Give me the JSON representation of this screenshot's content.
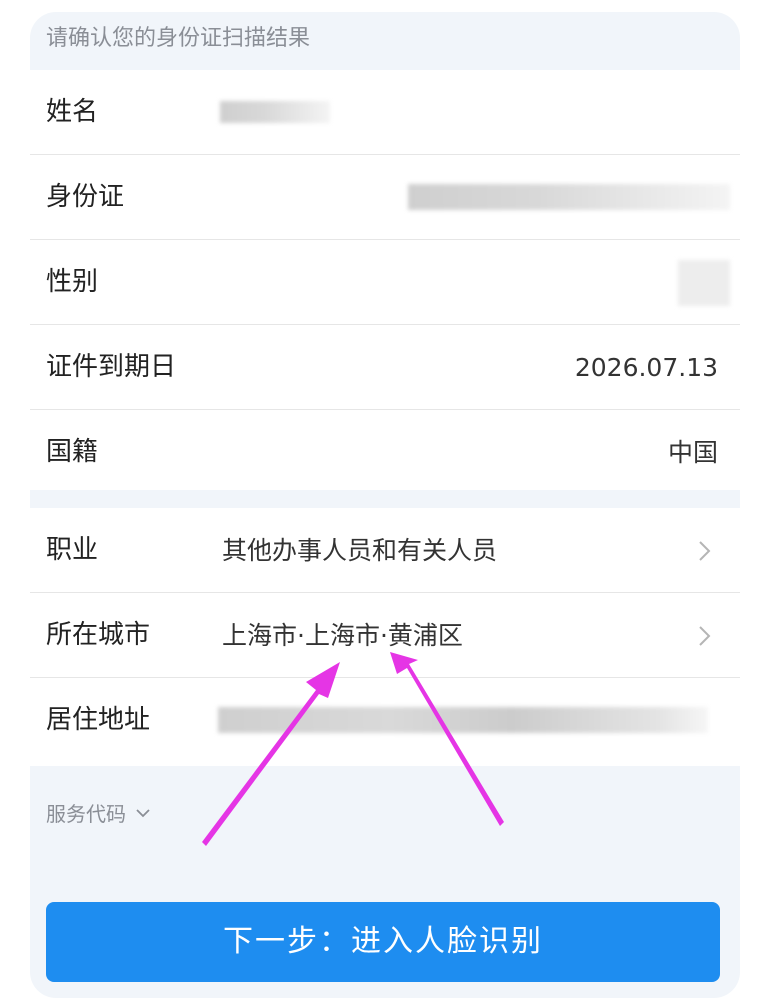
{
  "header": {
    "title": "请确认您的身份证扫描结果"
  },
  "id_info": {
    "name_label": "姓名",
    "id_label": "身份证",
    "gender_label": "性别",
    "expiry_label": "证件到期日",
    "expiry_value": "2026.07.13",
    "nationality_label": "国籍",
    "nationality_value": "中国"
  },
  "profile": {
    "occupation_label": "职业",
    "occupation_value": "其他办事人员和有关人员",
    "city_label": "所在城市",
    "city_value": "上海市·上海市·黄浦区",
    "address_label": "居住地址"
  },
  "footer": {
    "service_code_label": "服务代码",
    "next_button_label": "下一步：进入人脸识别"
  },
  "colors": {
    "accent": "#1e8df0",
    "annotation_arrow": "#e535e5"
  },
  "icons": {
    "chevron": "chevron-right-icon",
    "expand": "chevron-down-icon"
  }
}
